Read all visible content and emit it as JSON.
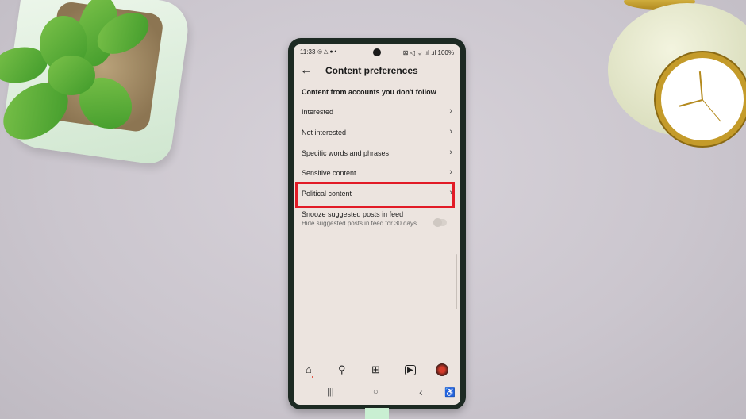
{
  "status_bar": {
    "time": "11:33",
    "left_icons": "◎ △ ● •",
    "right_icons": "⊠ ◁ ᯤ .ıl .ıl",
    "battery": "100%"
  },
  "header": {
    "back_icon": "←",
    "title": "Content preferences"
  },
  "section_title": "Content from accounts you don't follow",
  "items": [
    {
      "label": "Interested",
      "chevron": "›"
    },
    {
      "label": "Not interested",
      "chevron": "›"
    },
    {
      "label": "Specific words and phrases",
      "chevron": "›"
    },
    {
      "label": "Sensitive content",
      "chevron": "›"
    },
    {
      "label": "Political content",
      "chevron": "›",
      "highlighted": true
    }
  ],
  "snooze": {
    "title": "Snooze suggested posts in feed",
    "subtitle": "Hide suggested posts in feed for 30 days.",
    "enabled": false
  },
  "bottom_nav": {
    "home": "⌂",
    "search": "⚲",
    "create": "⊞",
    "reels": "▶",
    "profile": ""
  },
  "system_nav": {
    "recents": "|||",
    "home": "○",
    "back": "‹",
    "accessibility": "♿"
  },
  "colors": {
    "highlight": "#e21b26",
    "screen_bg": "#ece4df"
  }
}
